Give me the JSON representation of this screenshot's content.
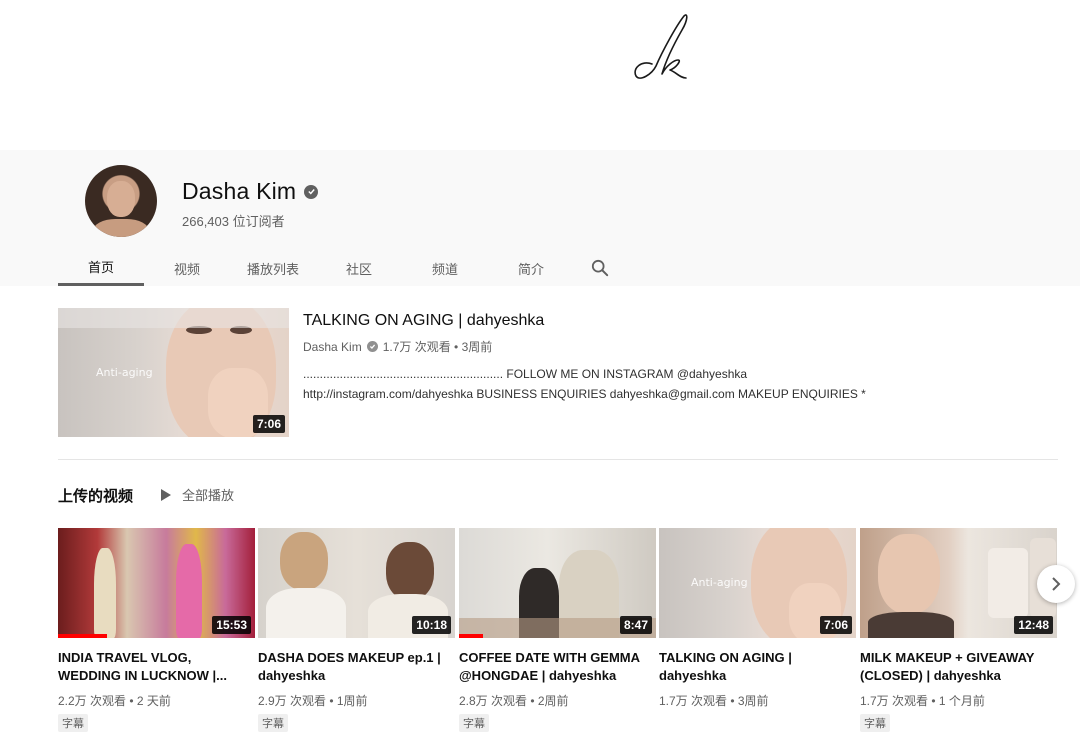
{
  "channel": {
    "name": "Dasha Kim",
    "subscribers": "266,403 位订阅者"
  },
  "tabs": [
    "首页",
    "视频",
    "播放列表",
    "社区",
    "频道",
    "简介"
  ],
  "featured": {
    "title": "TALKING ON AGING | dahyeshka",
    "channel": "Dasha Kim",
    "stats": "1.7万 次观看 • 3周前",
    "desc_line1": "............................................................ FOLLOW ME ON INSTAGRAM @dahyeshka",
    "desc_line2": "http://instagram.com/dahyeshka BUSINESS ENQUIRIES dahyeshka@gmail.com MAKEUP ENQUIRIES *",
    "thumb_text": "Anti-aging",
    "duration": "7:06"
  },
  "shelf": {
    "title": "上传的视频",
    "play_all": "全部播放"
  },
  "videos": [
    {
      "title": "INDIA TRAVEL VLOG, WEDDING IN LUCKNOW |...",
      "stats": "2.2万 次观看 • 2 天前",
      "duration": "15:53",
      "badge": "字幕",
      "progress": 0.25
    },
    {
      "title": "DASHA DOES MAKEUP ep.1 | dahyeshka",
      "stats": "2.9万 次观看 • 1周前",
      "duration": "10:18",
      "badge": "字幕",
      "progress": 0
    },
    {
      "title": "COFFEE DATE WITH GEMMA @HONGDAE | dahyeshka",
      "stats": "2.8万 次观看 • 2周前",
      "duration": "8:47",
      "badge": "字幕",
      "progress": 0.12
    },
    {
      "title": "TALKING ON AGING | dahyeshka",
      "stats": "1.7万 次观看 • 3周前",
      "duration": "7:06",
      "badge": "",
      "progress": 0,
      "thumb_text": "Anti-aging"
    },
    {
      "title": "MILK MAKEUP + GIVEAWAY (CLOSED) | dahyeshka",
      "stats": "1.7万 次观看 • 1 个月前",
      "duration": "12:48",
      "badge": "字幕",
      "progress": 0
    }
  ],
  "colors": {
    "accent": "#ff0000",
    "header_bg": "#f9f9f9",
    "secondary_text": "#606060"
  },
  "icons": [
    "signature-logo",
    "verified-icon",
    "search-icon",
    "play-icon",
    "chevron-right-icon"
  ]
}
